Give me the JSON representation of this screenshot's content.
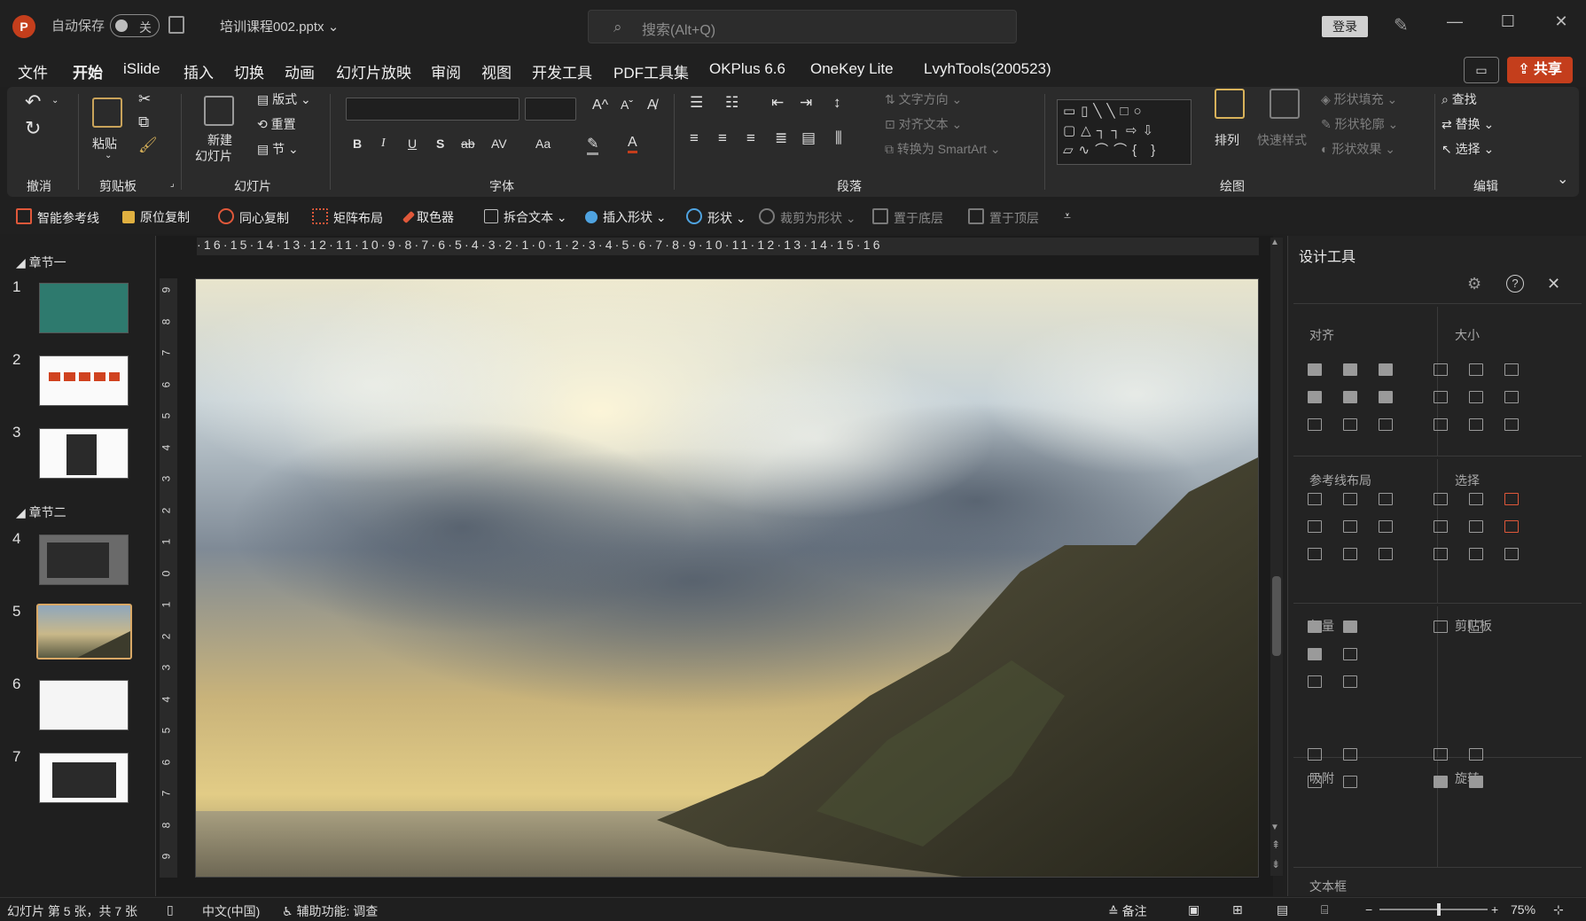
{
  "titlebar": {
    "autosave_label": "自动保存",
    "toggle_label": "关",
    "filename": "培训课程002.pptx",
    "search_placeholder": "搜索(Alt+Q)",
    "login_label": "登录"
  },
  "menu": {
    "tabs": [
      "文件",
      "开始",
      "iSlide",
      "插入",
      "切换",
      "动画",
      "幻灯片放映",
      "审阅",
      "视图",
      "开发工具",
      "PDF工具集",
      "OKPlus 6.6",
      "OneKey Lite",
      "LvyhTools(200523)"
    ],
    "active": "开始",
    "share_label": "共享"
  },
  "ribbon": {
    "groups": {
      "undo": "撤消",
      "clipboard": "剪贴板",
      "slides": "幻灯片",
      "font": "字体",
      "paragraph": "段落",
      "drawing": "绘图",
      "edit": "编辑"
    },
    "paste": "粘贴",
    "new_slide_1": "新建",
    "new_slide_2": "幻灯片",
    "layout": "版式",
    "reset": "重置",
    "section": "节",
    "text_direction": "文字方向",
    "align_text": "对齐文本",
    "smartart": "转换为 SmartArt",
    "arrange": "排列",
    "quick_styles": "快速样式",
    "shape_fill": "形状填充",
    "shape_outline": "形状轮廓",
    "shape_effects": "形状效果",
    "find": "查找",
    "replace": "替换",
    "select": "选择",
    "font_buttons": [
      "B",
      "I",
      "U",
      "S",
      "ab",
      "AV",
      "Aa"
    ]
  },
  "quickbar": {
    "items": [
      "智能参考线",
      "原位复制",
      "同心复制",
      "矩阵布局",
      "取色器",
      "拆合文本",
      "插入形状",
      "形状",
      "裁剪为形状",
      "置于底层",
      "置于顶层"
    ]
  },
  "slides_pane": {
    "section1": "章节一",
    "section2": "章节二",
    "numbers": [
      "1",
      "2",
      "3",
      "4",
      "5",
      "6",
      "7"
    ],
    "selected": 5
  },
  "ruler": {
    "h_ticks": "·16·15·14·13·12·11·10·9·8·7·6·5·4·3·2·1·0·1·2·3·4·5·6·7·8·9·10·11·12·13·14·15·16",
    "v_ticks": [
      "9",
      "8",
      "7",
      "6",
      "5",
      "4",
      "3",
      "2",
      "1",
      "0",
      "1",
      "2",
      "3",
      "4",
      "5",
      "6",
      "7",
      "8",
      "9"
    ]
  },
  "design_tools": {
    "title": "设计工具",
    "sections": {
      "align": "对齐",
      "size": "大小",
      "guides": "参考线布局",
      "select": "选择",
      "vector": "矢量",
      "clipboard": "剪贴板",
      "snap": "吸附",
      "rotate": "旋转",
      "textbox": "文本框"
    }
  },
  "status": {
    "slide_info": "幻灯片 第 5 张，共 7 张",
    "language": "中文(中国)",
    "accessibility": "辅助功能: 调查",
    "notes": "备注",
    "zoom": "75%"
  },
  "colors": {
    "accent": "#c43e1c",
    "selected_thumb_border": "#d9a866"
  }
}
